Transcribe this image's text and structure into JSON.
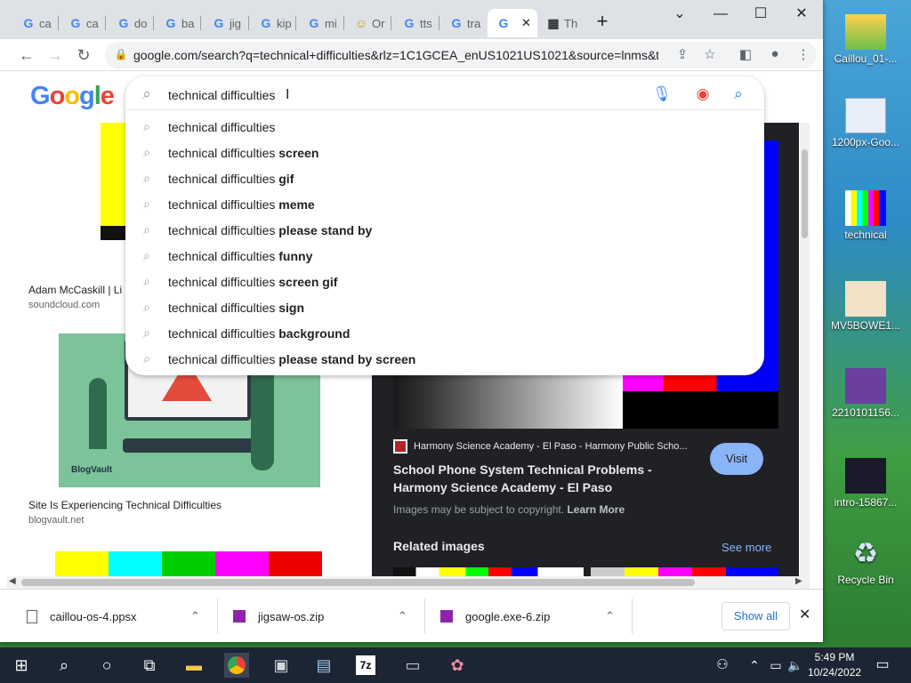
{
  "desktop": {
    "icons": [
      {
        "label": "Caillou_01-..."
      },
      {
        "label": "1200px-Goo..."
      },
      {
        "label": "technical"
      },
      {
        "label": "MV5BOWE1..."
      },
      {
        "label": "2210101156..."
      },
      {
        "label": "intro-15867..."
      },
      {
        "label": "Recycle Bin"
      }
    ]
  },
  "browser": {
    "tabs": [
      {
        "fav": "G",
        "label": "ca"
      },
      {
        "fav": "G",
        "label": "ca"
      },
      {
        "fav": "G",
        "label": "do"
      },
      {
        "fav": "G",
        "label": "ba"
      },
      {
        "fav": "G",
        "label": "jig"
      },
      {
        "fav": "G",
        "label": "kip"
      },
      {
        "fav": "G",
        "label": "mi"
      },
      {
        "fav": "☺",
        "label": "Or"
      },
      {
        "fav": "G",
        "label": "tts"
      },
      {
        "fav": "G",
        "label": "tra"
      },
      {
        "fav": "G",
        "label": ""
      },
      {
        "fav": "▦",
        "label": "Th"
      }
    ],
    "new_tab": "+",
    "url": "google.com/search?q=technical+difficulties&rlz=1C1GCEA_enUS1021US1021&source=lnms&t..."
  },
  "search": {
    "logo": "Google",
    "query": "technical difficulties",
    "suggestions": [
      {
        "base": "technical difficulties",
        "bold": ""
      },
      {
        "base": "technical difficulties ",
        "bold": "screen"
      },
      {
        "base": "technical difficulties ",
        "bold": "gif"
      },
      {
        "base": "technical difficulties ",
        "bold": "meme"
      },
      {
        "base": "technical difficulties ",
        "bold": "please stand by"
      },
      {
        "base": "technical difficulties ",
        "bold": "funny"
      },
      {
        "base": "technical difficulties ",
        "bold": "screen gif"
      },
      {
        "base": "technical difficulties ",
        "bold": "sign"
      },
      {
        "base": "technical difficulties ",
        "bold": "background"
      },
      {
        "base": "technical difficulties ",
        "bold": "please stand by screen"
      }
    ]
  },
  "results": {
    "left": [
      {
        "caption": "Adam McCaskill | Li",
        "source": "soundcloud.com"
      },
      {
        "caption": "Site Is Experiencing Technical Difficulties",
        "source": "blogvault.net"
      }
    ],
    "blogvault_mark": "BlogVault",
    "panel": {
      "source": "Harmony Science Academy - El Paso - Harmony Public Scho...",
      "title": "School Phone System Technical Problems - Harmony Science Academy - El Paso",
      "visit": "Visit",
      "copyright": "Images may be subject to copyright.",
      "learn_more": "Learn More",
      "related": "Related images",
      "see_more": "See more"
    }
  },
  "downloads": {
    "items": [
      {
        "name": "caillou-os-4.ppsx"
      },
      {
        "name": "jigsaw-os.zip"
      },
      {
        "name": "google.exe-6.zip"
      }
    ],
    "show_all": "Show all"
  },
  "taskbar": {
    "time": "5:49 PM",
    "date": "10/24/2022"
  }
}
